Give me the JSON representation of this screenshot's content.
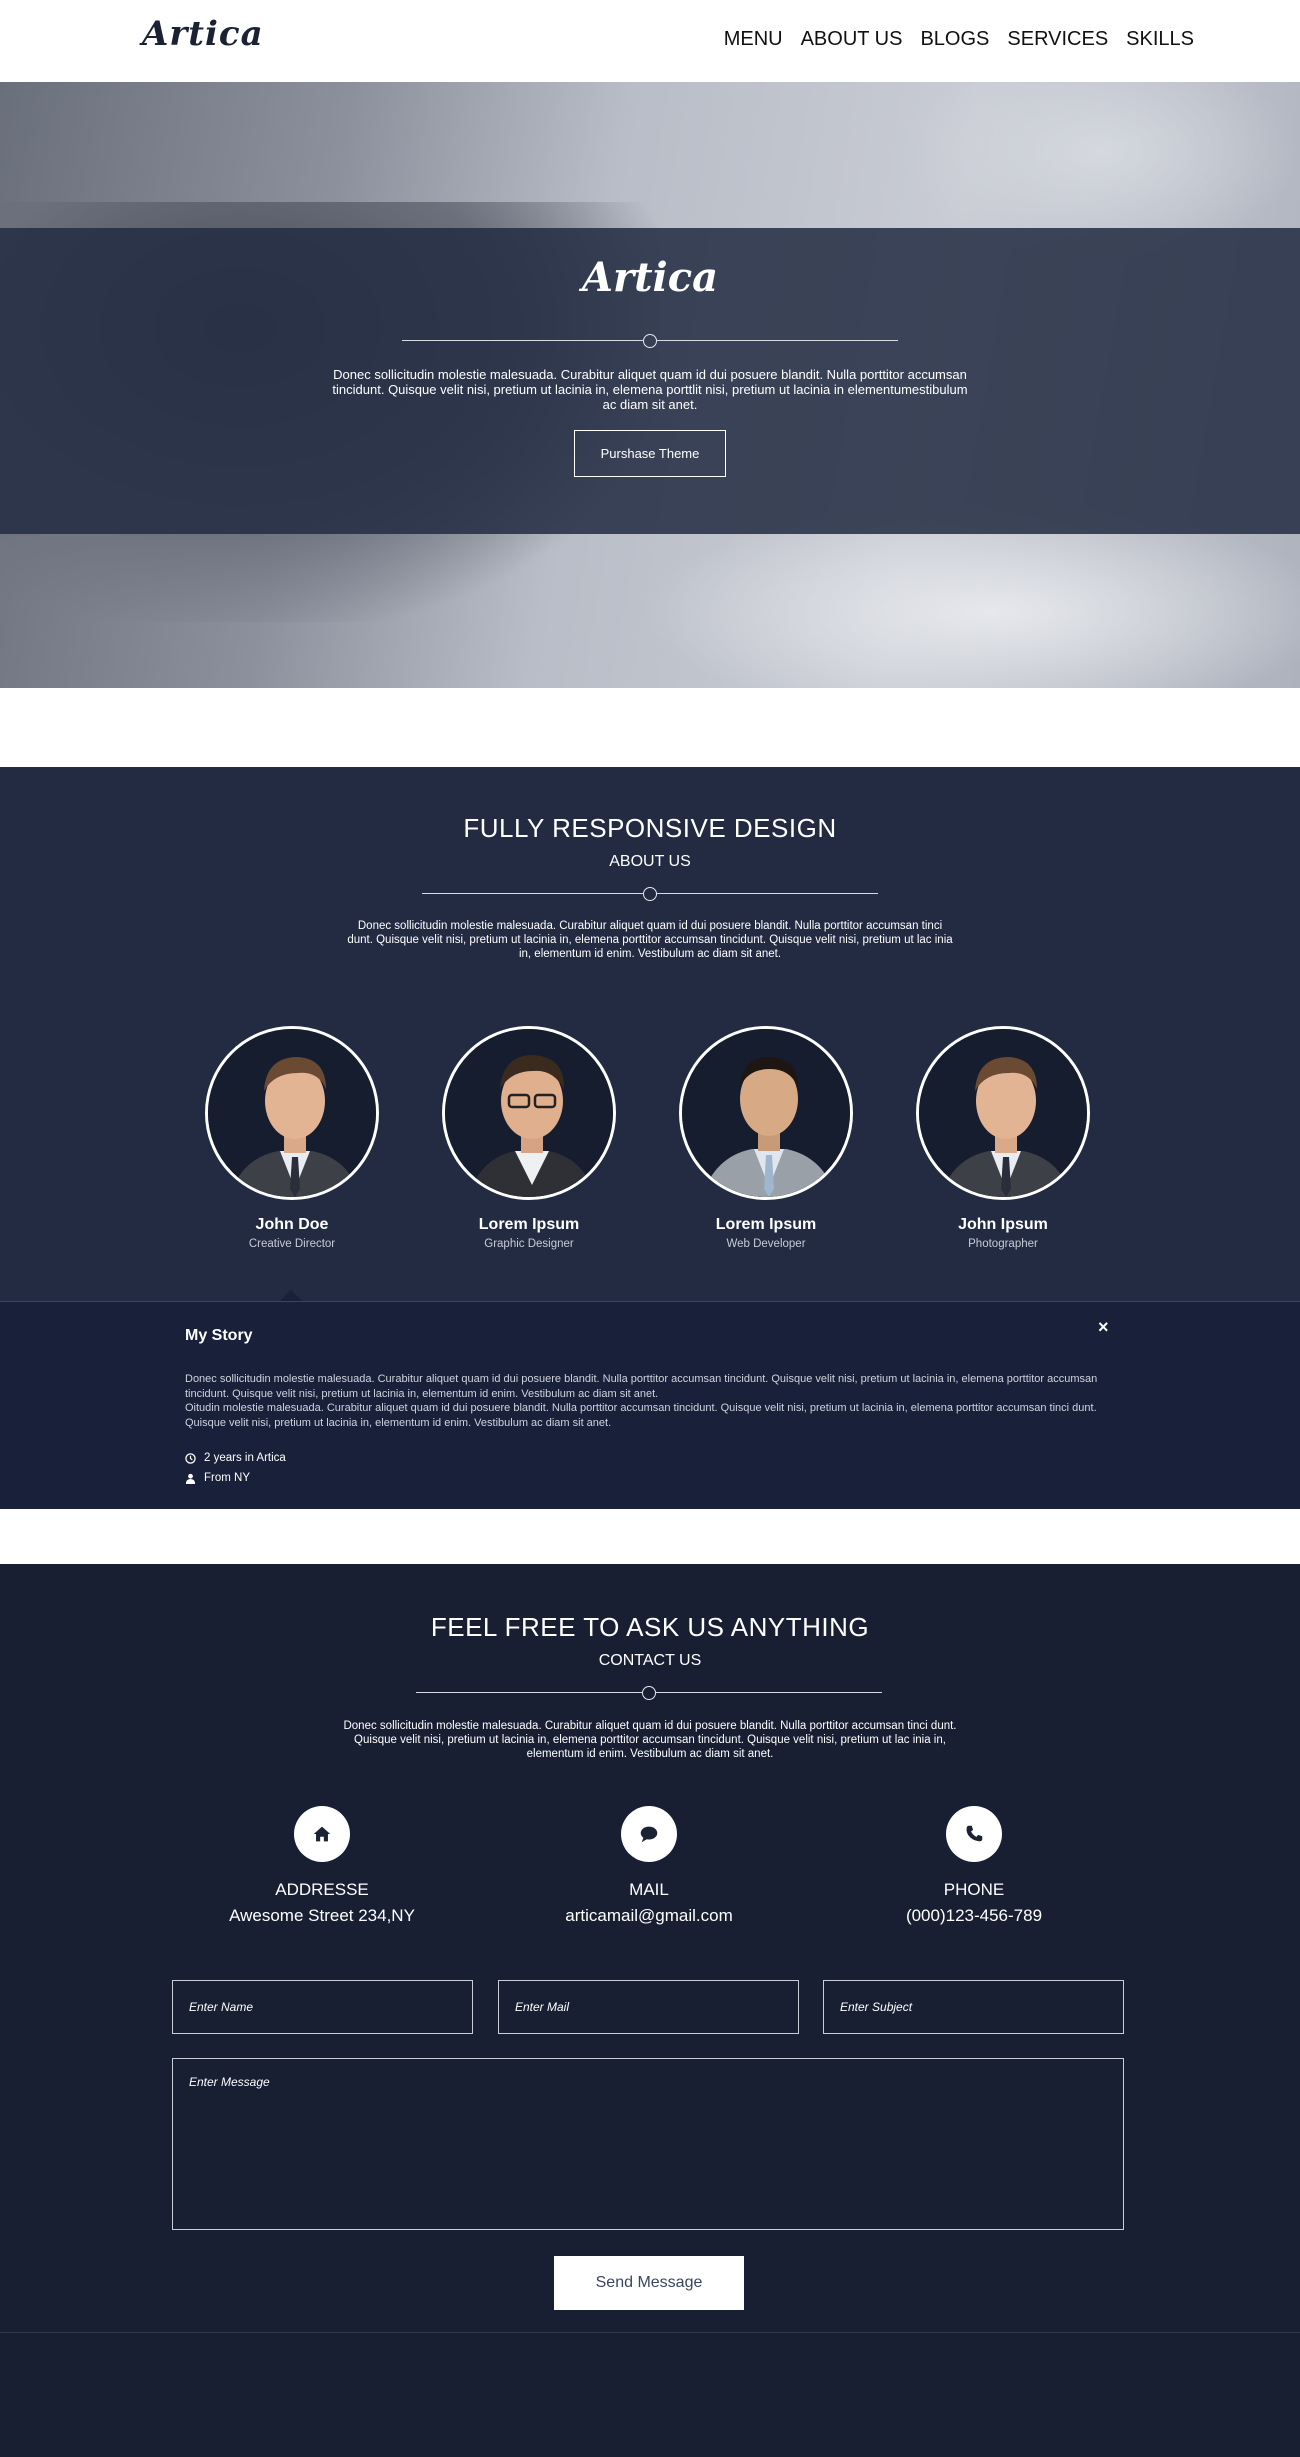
{
  "header": {
    "logo": "Artica",
    "nav": [
      "MENU",
      "ABOUT US",
      "BLOGS",
      "SERVICES",
      "SKILLS"
    ]
  },
  "hero": {
    "title": "Artica",
    "text": "Donec sollicitudin molestie malesuada. Curabitur aliquet quam id dui posuere blandit. Nulla porttitor accumsan tincidunt. Quisque velit nisi, pretium ut lacinia in, elemena porttlit nisi, pretium ut lacinia in elementumestibulum ac diam sit anet.",
    "button": "Purshase Theme"
  },
  "about": {
    "title": "FULLY RESPONSIVE DESIGN",
    "subtitle": "ABOUT US",
    "text": "Donec sollicitudin molestie malesuada. Curabitur aliquet quam id dui posuere blandit. Nulla porttitor accumsan tinci dunt. Quisque velit nisi, pretium ut lacinia in, elemena porttitor accumsan tincidunt. Quisque velit nisi, pretium ut lac inia in, elementum id enim. Vestibulum ac diam sit anet.",
    "members": [
      {
        "name": "John Doe",
        "role": "Creative Director"
      },
      {
        "name": "Lorem Ipsum",
        "role": "Graphic Designer"
      },
      {
        "name": "Lorem Ipsum",
        "role": "Web Developer"
      },
      {
        "name": "John Ipsum",
        "role": "Photographer"
      }
    ]
  },
  "story": {
    "title": "My Story",
    "close": "×",
    "paragraph1": "Donec sollicitudin molestie malesuada. Curabitur aliquet quam id dui posuere blandit. Nulla porttitor accumsan tincidunt. Quisque velit nisi, pretium ut lacinia in, elemena porttitor accumsan tincidunt. Quisque velit nisi, pretium ut lacinia in, elementum id enim. Vestibulum ac diam sit anet.",
    "paragraph2": "Oitudin molestie malesuada. Curabitur aliquet quam id dui posuere blandit. Nulla porttitor accumsan tincidunt. Quisque velit nisi, pretium ut lacinia in, elemena porttitor accumsan tinci dunt. Quisque velit nisi, pretium ut lacinia in, elementum id enim. Vestibulum ac diam sit anet.",
    "meta": [
      "2 years in Artica",
      "From NY"
    ]
  },
  "contact": {
    "title": "FEEL FREE TO ASK US ANYTHING",
    "subtitle": "CONTACT US",
    "text": "Donec sollicitudin molestie malesuada. Curabitur aliquet quam id dui posuere blandit. Nulla porttitor accumsan tinci dunt. Quisque velit nisi, pretium ut lacinia in, elemena porttitor accumsan tincidunt. Quisque velit nisi, pretium ut lac inia in, elementum id enim. Vestibulum ac diam sit anet.",
    "info": [
      {
        "icon": "home-icon",
        "label": "ADDRESSE",
        "value": "Awesome Street 234,NY"
      },
      {
        "icon": "chat-bubble-icon",
        "label": "MAIL",
        "value": "articamail@gmail.com"
      },
      {
        "icon": "phone-icon",
        "label": "PHONE",
        "value": "(000)123-456-789"
      }
    ],
    "form": {
      "name_placeholder": "Enter Name",
      "mail_placeholder": "Enter Mail",
      "subject_placeholder": "Enter Subject",
      "message_placeholder": "Enter Message",
      "send": "Send Message"
    }
  }
}
